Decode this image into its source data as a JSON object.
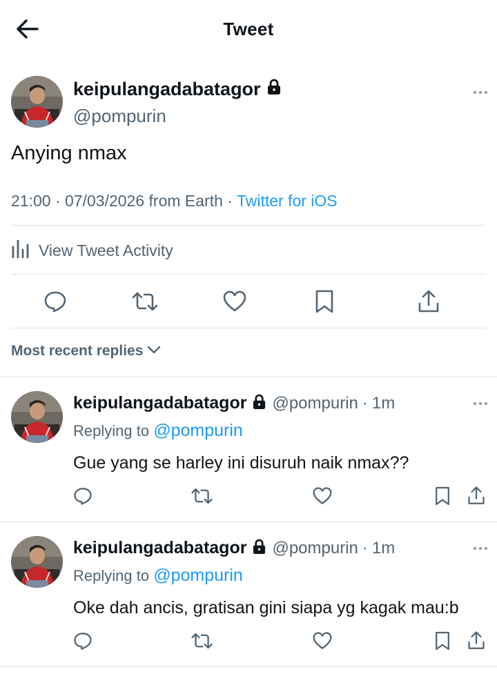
{
  "header": {
    "title": "Tweet"
  },
  "tweet": {
    "name": "keipulangadabatagor",
    "handle": "@pompurin",
    "text": "Anying nmax",
    "time": "21:00",
    "date": "07/03/2026",
    "location": "from Earth",
    "source": "Twitter for iOS"
  },
  "activity": {
    "label": "View Tweet Activity"
  },
  "sort": {
    "label": "Most recent replies"
  },
  "replies": [
    {
      "name": "keipulangadabatagor",
      "handle": "@pompurin",
      "age": "1m",
      "replying_label": "Replying to",
      "replying_to": "@pompurin",
      "text": "Gue yang se harley ini disuruh naik nmax??"
    },
    {
      "name": "keipulangadabatagor",
      "handle": "@pompurin",
      "age": "1m",
      "replying_label": "Replying to",
      "replying_to": "@pompurin",
      "text": "Oke dah ancis, gratisan gini siapa yg kagak mau:b"
    }
  ],
  "colors": {
    "accent": "#1d9bf0",
    "secondary_text": "#536471",
    "primary_text": "#0f1419",
    "divider": "#dfe3e6"
  },
  "icons": [
    "back-arrow-icon",
    "lock-icon",
    "more-icon",
    "activity-chart-icon",
    "reply-icon",
    "retweet-icon",
    "like-icon",
    "bookmark-icon",
    "share-icon",
    "chevron-down-icon"
  ]
}
